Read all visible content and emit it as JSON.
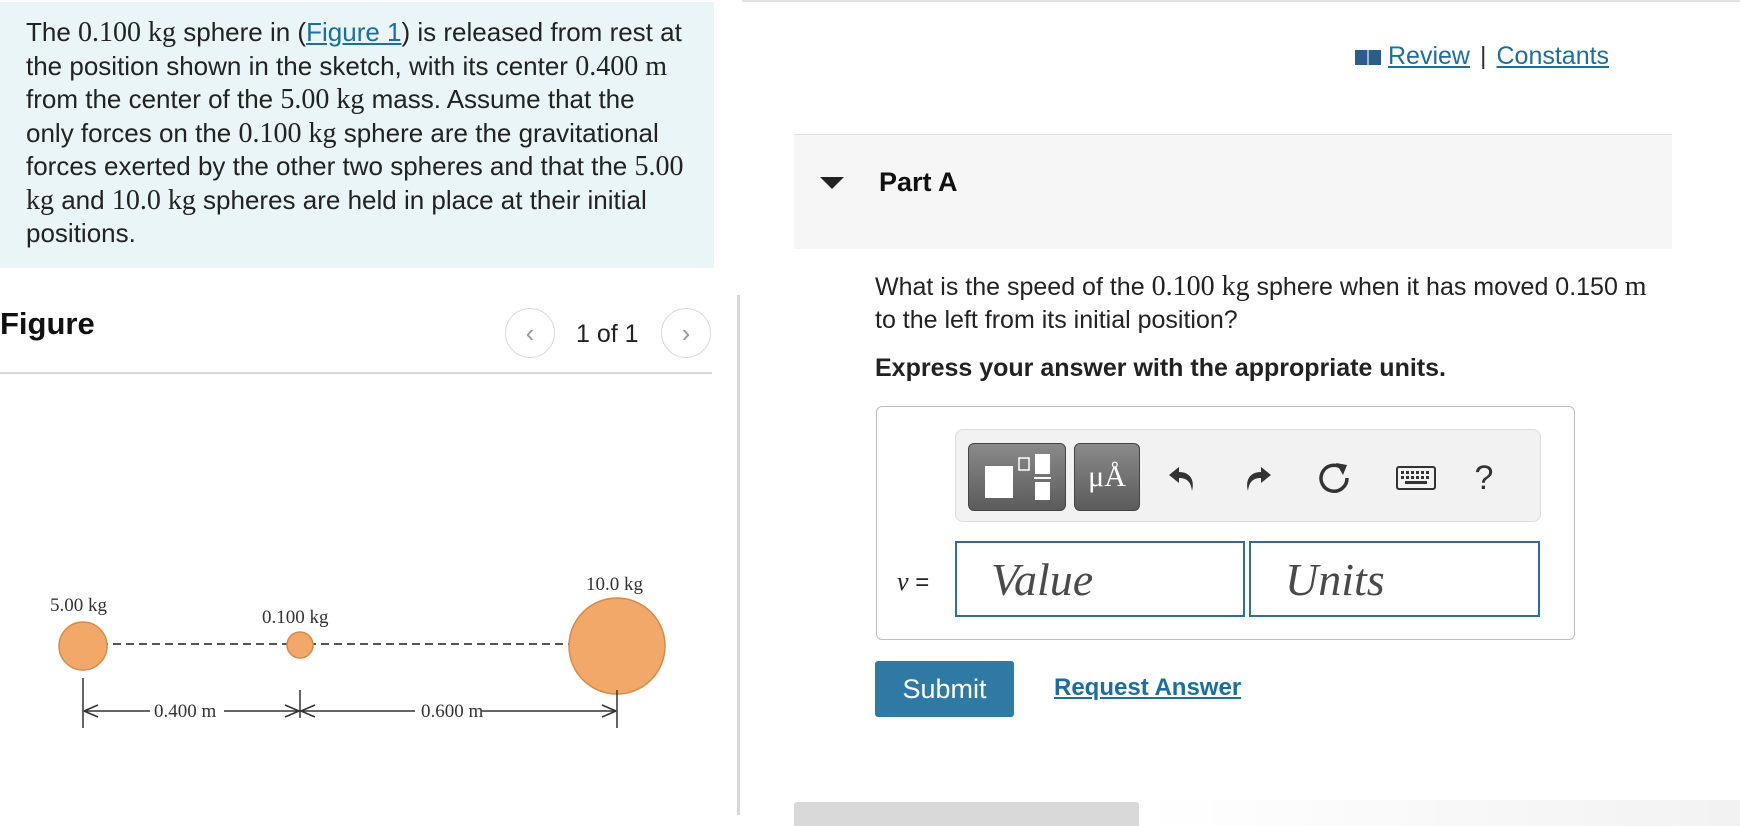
{
  "problem": {
    "t1": "The ",
    "mass1": "0.100 kg",
    "t2": " sphere in (",
    "figure_link": "Figure 1",
    "t3": ") is released from rest at the position shown in the sketch, with its center ",
    "dist": "0.400 m",
    "t4": " from the center of the ",
    "mass2": "5.00 kg",
    "t5": " mass. Assume that the only forces on the ",
    "mass3": "0.100 kg",
    "t6": " sphere are the gravitational forces exerted by the other two spheres and that the ",
    "mass4": "5.00 kg",
    "t7": " and ",
    "mass5": "10.0 kg",
    "t8": " spheres are held in place at their initial positions."
  },
  "figure": {
    "title": "Figure",
    "pager": "1 of 1",
    "labels": {
      "m5": "5.00 kg",
      "m01": "0.100 kg",
      "m10": "10.0 kg",
      "d1": "0.400 m",
      "d2": "0.600 m"
    },
    "colors": {
      "sphere_fill": "#f2a868",
      "sphere_stroke": "#d98a4a"
    }
  },
  "header": {
    "review": "Review",
    "separator": "|",
    "constants": "Constants"
  },
  "part": {
    "title": "Part A"
  },
  "question": {
    "t1": "What is the speed of the ",
    "mass": "0.100 kg",
    "t2": " sphere when it has moved 0.150 ",
    "unit": "m",
    "t3": " to the left from its initial position?"
  },
  "instruction": "Express your answer with the appropriate units.",
  "answer": {
    "variable": "v",
    "equals": " =",
    "value_placeholder": "Value",
    "units_placeholder": "Units",
    "units_button": "μÅ",
    "help": "?"
  },
  "actions": {
    "submit": "Submit",
    "request": "Request Answer"
  },
  "colors": {
    "accent": "#2f7aa4",
    "link": "#1a6ea0",
    "problem_bg": "#e9f5f6"
  }
}
